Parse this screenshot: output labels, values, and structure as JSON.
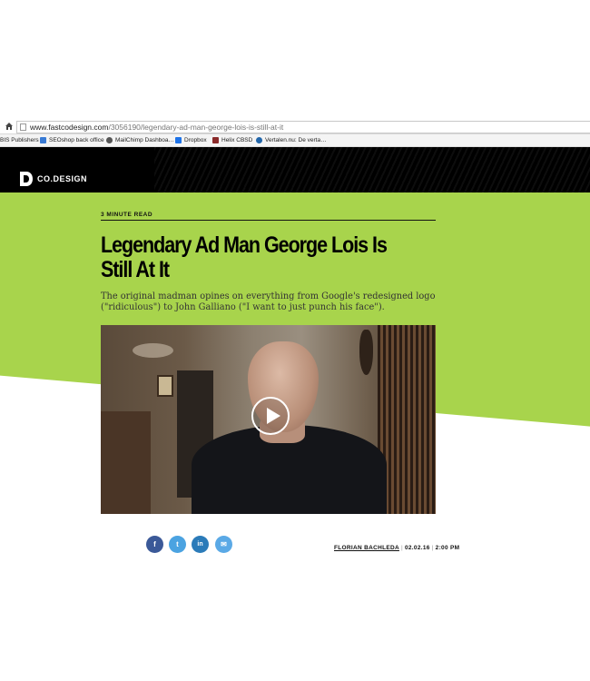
{
  "browser": {
    "url_domain": "www.fastcodesign.com",
    "url_path": "/3056190/legendary-ad-man-george-lois-is-still-at-it",
    "bookmarks": [
      {
        "label": "BIS Publishers",
        "color": "#ffffff"
      },
      {
        "label": "SEOshop back office",
        "color": "#3a7bd5"
      },
      {
        "label": "MailChimp Dashboa…",
        "color": "#555555"
      },
      {
        "label": "Dropbox",
        "color": "#1e73e8"
      },
      {
        "label": "Helix CBSD",
        "color": "#8b2b2b"
      },
      {
        "label": "Vertalen.nu: De verta…",
        "color": "#2266aa"
      }
    ]
  },
  "site": {
    "logo_text": "CO.DESIGN"
  },
  "article": {
    "read_time": "3 MINUTE READ",
    "headline": "Legendary Ad Man George Lois Is Still At It",
    "dek": "The original madman opines on everything from Google's redesigned logo (\"ridiculous\") to John Galliano (\"I want to just punch his face\").",
    "author": "FLORIAN BACHLEDA",
    "date": "02.02.16",
    "time": "2:00 PM"
  },
  "share": [
    {
      "icon": "facebook-icon",
      "glyph": "f",
      "color": "#3b5998"
    },
    {
      "icon": "twitter-icon",
      "glyph": "t",
      "color": "#4ba3e1"
    },
    {
      "icon": "linkedin-icon",
      "glyph": "in",
      "color": "#2b7bb9"
    },
    {
      "icon": "email-icon",
      "glyph": "✉",
      "color": "#5aa9e6"
    }
  ],
  "colors": {
    "accent_green": "#a8d44c",
    "header_black": "#000000"
  }
}
